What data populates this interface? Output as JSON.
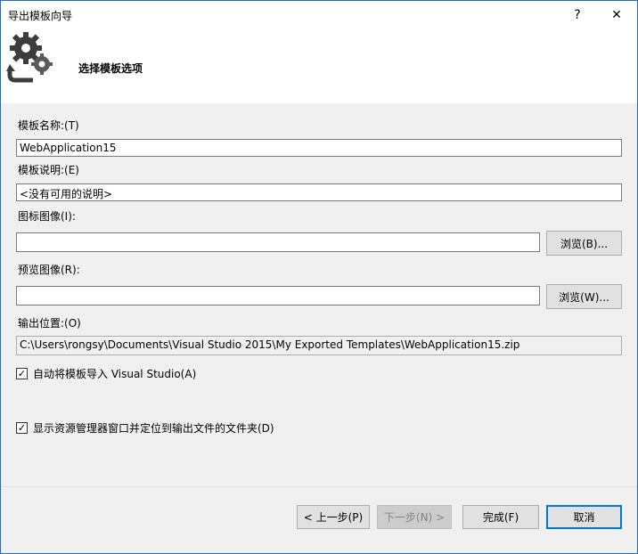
{
  "window": {
    "title": "导出模板向导",
    "help_glyph": "?",
    "close_glyph": "✕"
  },
  "header": {
    "title": "选择模板选项",
    "icon": "gear-arrow-icon"
  },
  "form": {
    "template_name": {
      "label": "模板名称:(T)",
      "value": "WebApplication15"
    },
    "template_desc": {
      "label": "模板说明:(E)",
      "value": "<没有可用的说明>"
    },
    "icon_image": {
      "label": "图标图像(I):",
      "value": "",
      "browse_label": "浏览(B)..."
    },
    "preview_image": {
      "label": "预览图像(R):",
      "value": "",
      "browse_label": "浏览(W)..."
    },
    "output_location": {
      "label": "输出位置:(O)",
      "value": "C:\\Users\\rongsy\\Documents\\Visual Studio 2015\\My Exported Templates\\WebApplication15.zip"
    },
    "auto_import": {
      "label": "自动将模板导入 Visual Studio(A)",
      "checked": true
    },
    "show_explorer": {
      "label": "显示资源管理器窗口并定位到输出文件的文件夹(D)",
      "checked": true
    }
  },
  "footer": {
    "back_label": "< 上一步(P)",
    "next_label": "下一步(N) >",
    "finish_label": "完成(F)",
    "cancel_label": "取消"
  }
}
